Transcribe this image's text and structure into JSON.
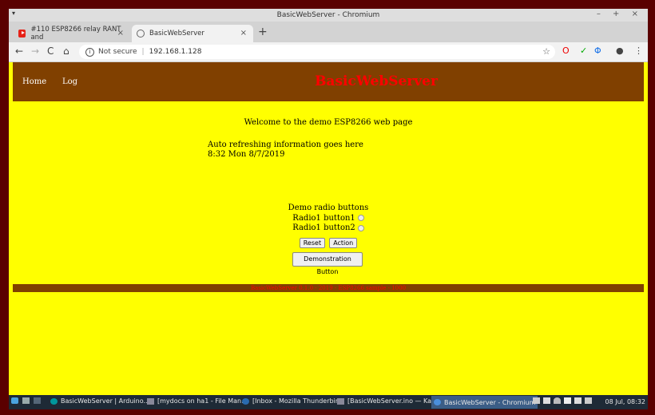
{
  "browser": {
    "window_title": "BasicWebServer - Chromium",
    "tabs": [
      {
        "label": "#110 ESP8266 relay RANT and",
        "close": "×"
      },
      {
        "label": "BasicWebServer",
        "close": "×"
      }
    ],
    "new_tab": "+",
    "nav": {
      "back": "←",
      "forward": "→",
      "reload": "C",
      "home": "⌂"
    },
    "security": "Not secure",
    "url": "192.168.1.128",
    "info_glyph": "i",
    "separator": "|",
    "star": "☆",
    "window_controls": "– + ×",
    "menu_arrow": "▾",
    "menu_dots": "⋮",
    "ext_opera": "O",
    "ext_wifi": "✓",
    "ext_other": "Φ",
    "profile": "●"
  },
  "page": {
    "nav_links": [
      "Home",
      "Log"
    ],
    "brand": "BasicWebServer",
    "welcome": "Welcome to the demo ESP8266 web page",
    "auto_refresh": "Auto refreshing information goes here",
    "timestamp": "8:32 Mon 8/7/2019",
    "radio_heading": "Demo radio buttons",
    "radio1": "Radio1 button1",
    "radio2": "Radio1 button2",
    "reset_button": "Reset",
    "action_button": "Action",
    "demo_button": "Demonstration Button",
    "footer_text": "BasicWebServer 0.1.0 - 2019 - ESP8266 sample - 1000"
  },
  "taskbar": {
    "items": [
      "BasicWebServer | Arduino...",
      "[mydocs on ha1 - File Man...",
      "[Inbox - Mozilla Thunderbird]",
      "[BasicWebServer.ino — Ka...",
      "BasicWebServer - Chromium"
    ],
    "clock": "08 Jul, 08:32"
  },
  "colors": {
    "header_bg": "#804000",
    "page_bg": "#ffff00",
    "brand": "#ff0000"
  }
}
